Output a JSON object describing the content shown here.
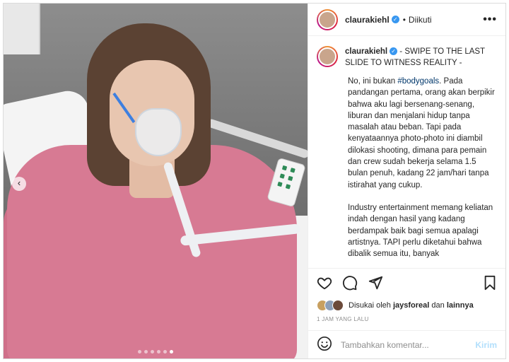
{
  "post": {
    "username": "claurakiehl",
    "follow_separator": "•",
    "follow_status": "Diikuti",
    "more_label": "•••",
    "caption_title": "- SWIPE TO THE LAST SLIDE TO WITNESS REALITY -",
    "caption_p1_before": "No, ini bukan ",
    "caption_hashtag": "#bodygoals",
    "caption_p1_after": ". Pada pandangan pertama, orang akan berpikir bahwa aku lagi bersenang-senang, liburan dan menjalani hidup tanpa masalah atau beban. Tapi pada kenyataannya photo-photo ini diambil dilokasi shooting, dimana para pemain dan crew sudah bekerja selama 1.5 bulan penuh, kadang 22 jam/hari tanpa istirahat yang cukup.",
    "caption_p2": "Industry entertainment memang keliatan indah dengan hasil yang kadang berdampak baik bagi semua apalagi artistnya. TAPI perlu diketahui bahwa dibalik semua itu, banyak",
    "likes_prefix": "Disukai oleh ",
    "likes_user": "jaysforeal",
    "likes_middle": " dan ",
    "likes_others": "lainnya",
    "time_ago": "1 JAM YANG LALU",
    "comment_placeholder": "Tambahkan komentar...",
    "post_button": "Kirim"
  },
  "carousel": {
    "prev_label": "‹",
    "slide_count": 6,
    "active_slide": 6
  },
  "icons": {
    "like": "heart-icon",
    "comment": "comment-icon",
    "share": "share-icon",
    "save": "bookmark-icon",
    "emoji": "emoji-icon"
  },
  "colors": {
    "accent": "#3897f0",
    "hashtag": "#00376b",
    "post_button_disabled": "#b2dffc",
    "gown": "#d77a93"
  }
}
